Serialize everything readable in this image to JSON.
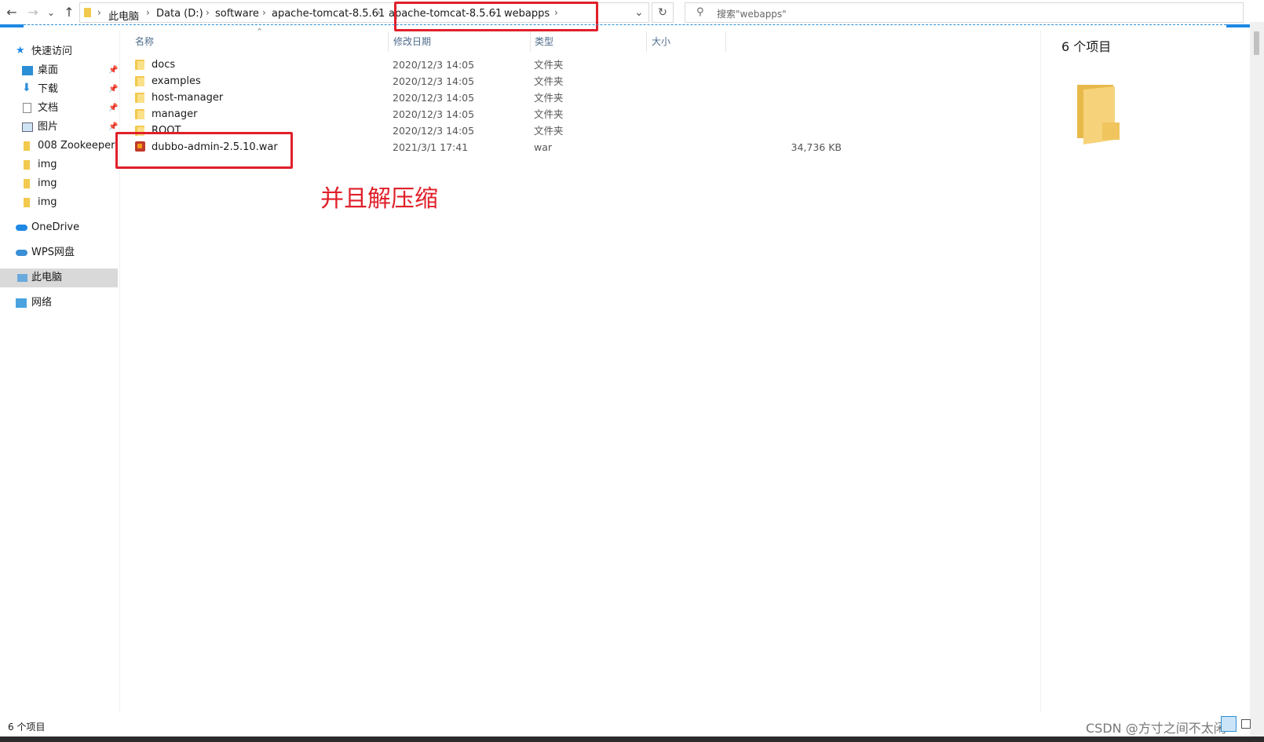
{
  "toolbar": {
    "back": "←",
    "forward": "→",
    "recent": "⌄",
    "up": "↑",
    "refresh": "↻",
    "dropdown": "⌄"
  },
  "breadcrumb": [
    "此电脑",
    "Data (D:)",
    "software",
    "apache-tomcat-8.5.61",
    "apache-tomcat-8.5.61",
    "webapps"
  ],
  "search": {
    "placeholder": "搜索\"webapps\""
  },
  "nav": {
    "quick_access": "快速访问",
    "desktop": "桌面",
    "downloads": "下载",
    "documents": "文档",
    "pictures": "图片",
    "folder1": "008 Zookeeper",
    "folder2": "img",
    "folder3": "img",
    "folder4": "img",
    "onedrive": "OneDrive",
    "wps": "WPS网盘",
    "thispc": "此电脑",
    "network": "网络"
  },
  "columns": {
    "name": "名称",
    "date": "修改日期",
    "type": "类型",
    "size": "大小"
  },
  "files": [
    {
      "name": "docs",
      "date": "2020/12/3 14:05",
      "type": "文件夹",
      "size": ""
    },
    {
      "name": "examples",
      "date": "2020/12/3 14:05",
      "type": "文件夹",
      "size": ""
    },
    {
      "name": "host-manager",
      "date": "2020/12/3 14:05",
      "type": "文件夹",
      "size": ""
    },
    {
      "name": "manager",
      "date": "2020/12/3 14:05",
      "type": "文件夹",
      "size": ""
    },
    {
      "name": "ROOT",
      "date": "2020/12/3 14:05",
      "type": "文件夹",
      "size": ""
    },
    {
      "name": "dubbo-admin-2.5.10.war",
      "date": "2021/3/1 17:41",
      "type": "war",
      "size": "34,736 KB"
    }
  ],
  "annotation": "并且解压缩",
  "preview": {
    "count": "6 个项目"
  },
  "status": {
    "count": "6 个项目"
  },
  "watermark": "CSDN @方寸之间不太闲",
  "colors": {
    "highlight": "#e0202a",
    "accent": "#1e88e5"
  }
}
